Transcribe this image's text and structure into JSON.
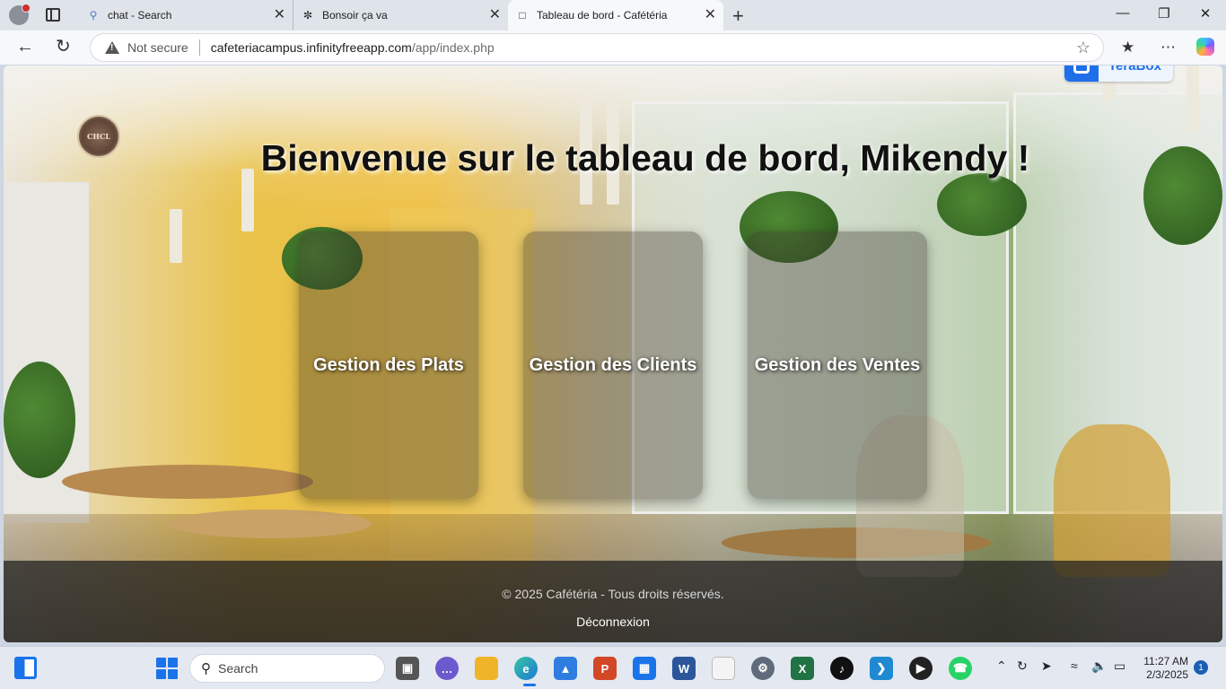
{
  "browser": {
    "tabs": [
      {
        "title": "chat - Search",
        "icon": "search-icon"
      },
      {
        "title": "Bonsoir ça va",
        "icon": "openai-icon"
      },
      {
        "title": "Tableau de bord - Cafétéria",
        "icon": "page-icon",
        "active": true
      }
    ],
    "address_bar": {
      "security": "Not secure",
      "host": "cafeteriacampus.infinityfreeapp.com",
      "path": "/app/index.php"
    }
  },
  "extension": {
    "terabox_label": "TeraBox"
  },
  "logo_text": "CHCL",
  "page": {
    "title": "Bienvenue sur le tableau de bord, Mikendy !",
    "cards": [
      {
        "label": "Gestion des Plats"
      },
      {
        "label": "Gestion des Clients"
      },
      {
        "label": "Gestion des Ventes"
      }
    ],
    "footer": {
      "copyright": "© 2025 Cafétéria - Tous droits réservés.",
      "logout": "Déconnexion"
    }
  },
  "taskbar": {
    "search_placeholder": "Search",
    "time": "11:27 AM",
    "date": "2/3/2025",
    "notification_count": "1",
    "apps": [
      "task-view",
      "chat",
      "file-explorer",
      "edge",
      "photos",
      "powerpoint",
      "store",
      "word",
      "notepad",
      "settings",
      "excel",
      "tiktok",
      "vscode",
      "media-player",
      "whatsapp"
    ]
  },
  "colors": {
    "accent": "#1a73e8",
    "footer_bg": "#1e1e1e",
    "card_overlay": "#3c372d"
  }
}
